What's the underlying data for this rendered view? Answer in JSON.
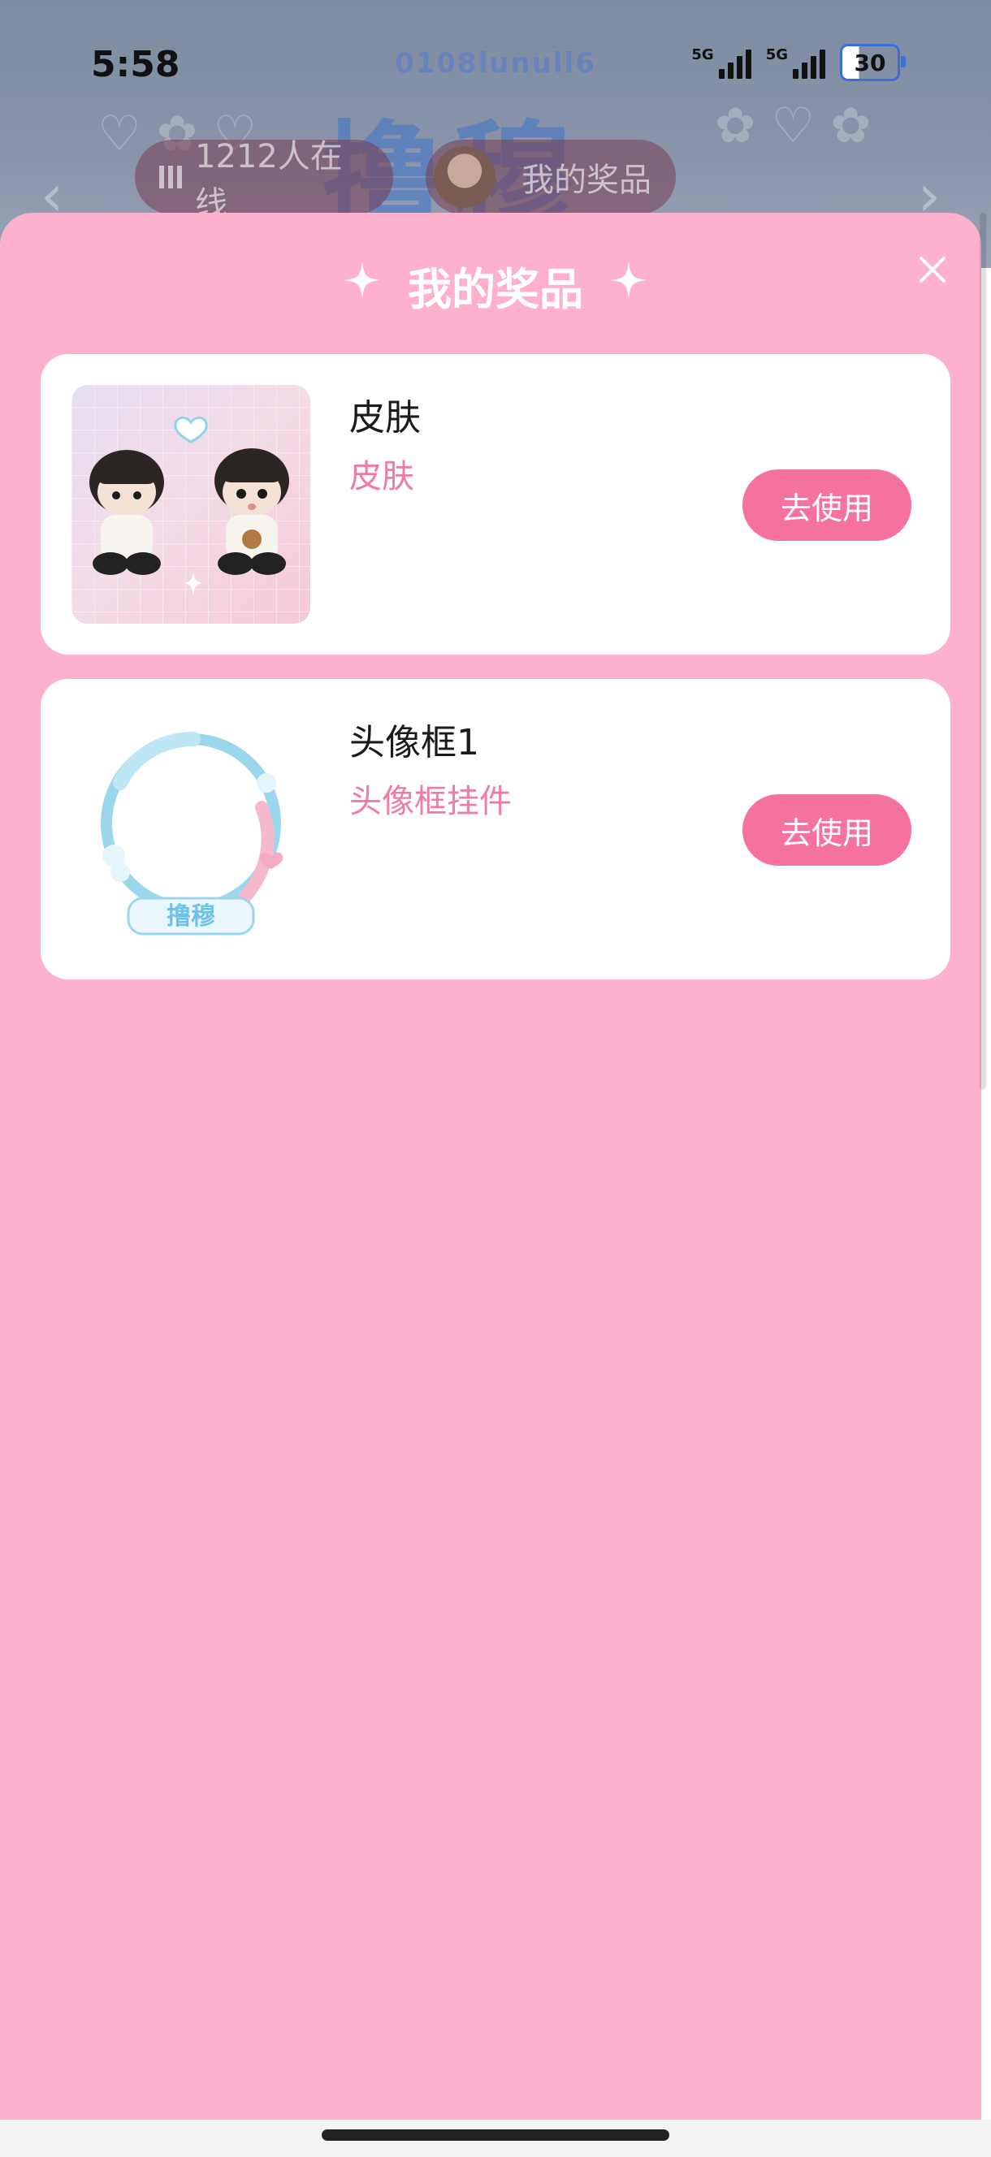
{
  "status_bar": {
    "time": "5:58",
    "signal1_label": "5G",
    "signal2_label": "5G",
    "battery": "30"
  },
  "background": {
    "logo_small": "0108lunull6",
    "logo_big": "撸穆",
    "online_pill": "1212人在线",
    "prize_pill": "我的奖品"
  },
  "modal": {
    "title": "我的奖品",
    "items": [
      {
        "name": "皮肤",
        "type": "皮肤",
        "button": "去使用"
      },
      {
        "name": "头像框1",
        "type": "头像框挂件",
        "button": "去使用"
      }
    ]
  },
  "colors": {
    "sheet_bg": "#feb1ce",
    "accent_button": "#f5729f",
    "type_text": "#f07aa8"
  }
}
